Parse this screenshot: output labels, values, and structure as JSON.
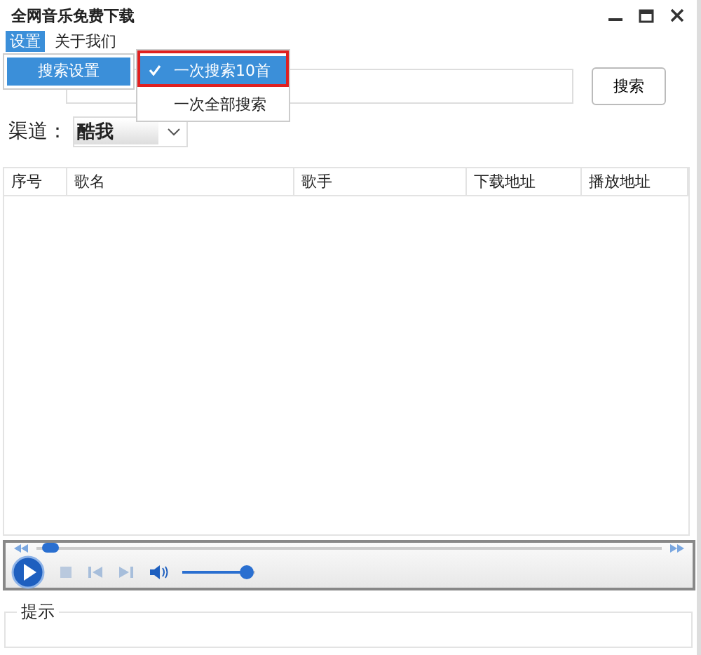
{
  "window": {
    "title": "全网音乐免费下载"
  },
  "menu": [
    {
      "label": "设置",
      "selected": true,
      "items": [
        {
          "label": "搜索设置",
          "selected": true,
          "children": [
            {
              "label": "一次搜索10首",
              "checked": true,
              "selected": true
            },
            {
              "label": "一次全部搜索",
              "checked": false,
              "selected": false
            }
          ]
        }
      ]
    },
    {
      "label": "关于我们",
      "selected": false
    }
  ],
  "search": {
    "button": "搜索"
  },
  "channel": {
    "label": "渠道：",
    "value": "酷我"
  },
  "table": {
    "columns": [
      "序号",
      "歌名",
      "歌手",
      "下载地址",
      "播放地址"
    ]
  },
  "player": {
    "seek": {
      "level": 0.01
    },
    "volume": {
      "level": 0.88
    }
  },
  "hint": {
    "title": "提示"
  }
}
